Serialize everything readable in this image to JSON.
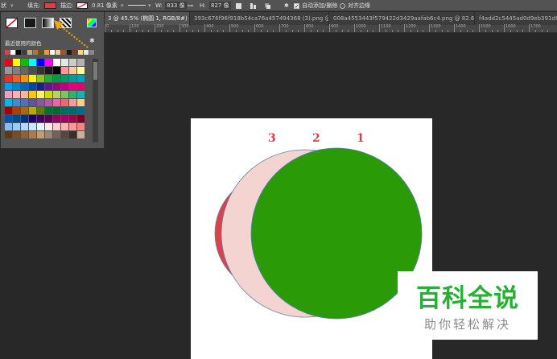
{
  "toolbar": {
    "mode_label": "状",
    "fill_label": "填充:",
    "stroke_label": "描边:",
    "stroke_width": "0.81 像素",
    "w_label": "W:",
    "w_value": "833 像",
    "h_label": "H:",
    "h_value": "827 像",
    "auto_add_delete_label": "自动添加/删除",
    "align_edges_label": "对齐边缘",
    "fill_color": "#d9424a",
    "link_glyph": "⊶",
    "gear_glyph": "✱"
  },
  "tabs": [
    {
      "label": "3 @ 45.5% (椭圆 1, RGB/8#) *",
      "close": "×"
    },
    {
      "label": "393c676f96f918b54ca76a457494368 (3).png @",
      "close": "×"
    },
    {
      "label": "008a4553443f579422d3429aafab6c4.png @ 82.6",
      "close": "×"
    },
    {
      "label": "f4add2c5445ad0d9eb391d8",
      "close": ""
    }
  ],
  "ruler": {
    "labels": [
      "0",
      "100",
      "200",
      "300",
      "400",
      "500",
      "600",
      "700",
      "800",
      "900",
      "1000",
      "1100",
      "1200",
      "1300",
      "1400",
      "1500",
      "1600",
      "1700"
    ]
  },
  "swatches_panel": {
    "recent_label": "最近使用的颜色",
    "gear_glyph": "✱",
    "recent_colors": [
      "#d9424a",
      "#ffffff",
      "#0a0a0a",
      "#3d3d3d",
      "#c7a87a",
      "#a57a3a",
      "#6b4f1d",
      "#ee9a2c",
      "#ffffff",
      "#f0c8a0",
      "#9b5a2d",
      "#1a1a1a",
      "#7a3d1e",
      "#ffd76b",
      "#e8e8e8",
      "#888888"
    ],
    "rows": [
      [
        "#e8001c",
        "#ffff00",
        "#00c200",
        "#00ffff",
        "#0000ff",
        "#ff00ff",
        "#ffffff",
        "#e6e6e6",
        "#cccccc",
        "#b3b3b3"
      ],
      [
        "#999999",
        "#808080",
        "#666666",
        "#4d4d4d",
        "#333333",
        "#1a1a1a",
        "#000000",
        "#ff9999",
        "#ffcc99",
        "#ffff99"
      ],
      [
        "#e6332a",
        "#ea6129",
        "#f39800",
        "#fff100",
        "#8fc31f",
        "#22ac38",
        "#009944",
        "#009b6b",
        "#009e96",
        "#00a0c1"
      ],
      [
        "#00a0e9",
        "#0086d1",
        "#0068b7",
        "#00479d",
        "#1d2088",
        "#601986",
        "#920783",
        "#be0081",
        "#e4007f",
        "#e5006a"
      ],
      [
        "#f19ec2",
        "#f5b2b2",
        "#f8b6a0",
        "#fcc800",
        "#fff45c",
        "#cfdb00",
        "#b3d465",
        "#80c269",
        "#32b16c",
        "#13b5b1"
      ],
      [
        "#00b7ee",
        "#448aca",
        "#556fb5",
        "#5f52a0",
        "#8957a1",
        "#ae5da1",
        "#ea68a2",
        "#eb6877",
        "#f29c9f",
        "#facd89"
      ],
      [
        "#a40000",
        "#a84200",
        "#ac6a00",
        "#b7aa00",
        "#5b7e00",
        "#007130",
        "#006934",
        "#006b60",
        "#00676b",
        "#006b8e"
      ],
      [
        "#0054a7",
        "#004a8e",
        "#00337a",
        "#1e0068",
        "#440062",
        "#600055",
        "#940061",
        "#a50064",
        "#a40048",
        "#7d0022"
      ],
      [
        "#7fbfff",
        "#99ccff",
        "#b3d9ff",
        "#cce6ff",
        "#e6f2ff",
        "#ffe6e6",
        "#ffcccc",
        "#ffb3b3",
        "#ff9999",
        "#ff8080"
      ],
      [
        "#603813",
        "#754c24",
        "#8c6239",
        "#a67c52",
        "#c69c6d",
        "#998675",
        "#736357",
        "#534741",
        "#362f2d",
        "#c7b299"
      ]
    ]
  },
  "canvas": {
    "labels": [
      "3",
      "2",
      "1"
    ],
    "circle_colors": {
      "red": "#d9424a",
      "pink": "#f3d4d0",
      "green": "#2a9a06"
    }
  },
  "watermark": {
    "title": "百科全说",
    "subtitle": "助你轻松解决"
  }
}
